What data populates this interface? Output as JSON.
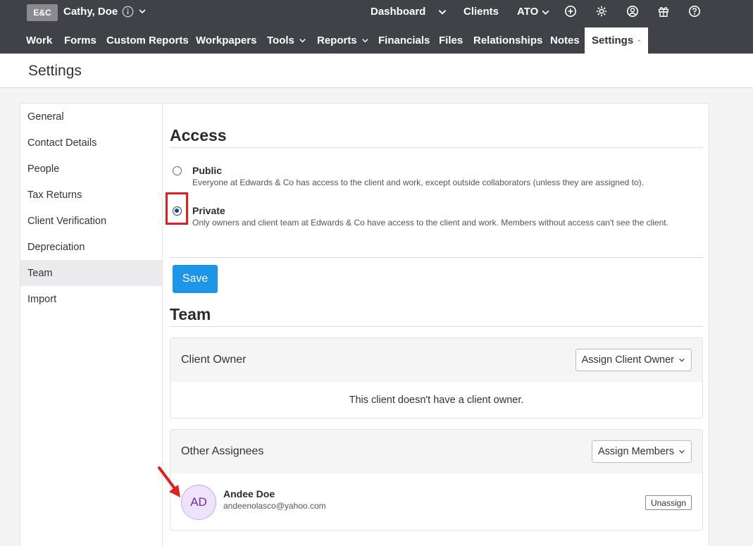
{
  "topbar": {
    "logo": "E&C",
    "client_name": "Cathy, Doe",
    "nav": {
      "dashboard": "Dashboard",
      "clients": "Clients",
      "ato": "ATO"
    }
  },
  "tabs": [
    "Work",
    "Forms",
    "Custom Reports",
    "Workpapers",
    "Tools",
    "Reports",
    "Financials",
    "Files",
    "Relationships",
    "Notes",
    "Settings"
  ],
  "page": {
    "title": "Settings"
  },
  "sidebar": {
    "items": [
      {
        "label": "General"
      },
      {
        "label": "Contact Details"
      },
      {
        "label": "People"
      },
      {
        "label": "Tax Returns"
      },
      {
        "label": "Client Verification"
      },
      {
        "label": "Depreciation"
      },
      {
        "label": "Team"
      },
      {
        "label": "Import"
      }
    ],
    "active": "Team"
  },
  "access": {
    "heading": "Access",
    "options": [
      {
        "title": "Public",
        "desc": "Everyone at Edwards & Co has access to the client and work, except outside collaborators (unless they are assigned to).",
        "selected": false
      },
      {
        "title": "Private",
        "desc": "Only owners and client team at Edwards & Co have access to the client and work. Members without access can't see the client.",
        "selected": true
      }
    ],
    "save_label": "Save"
  },
  "team": {
    "heading": "Team",
    "client_owner": {
      "title": "Client Owner",
      "button": "Assign Client Owner",
      "empty": "This client doesn't have a client owner."
    },
    "other_assignees": {
      "title": "Other Assignees",
      "button": "Assign Members",
      "members": [
        {
          "initials": "AD",
          "name": "Andee Doe",
          "email": "andeenolasco@yahoo.com",
          "action": "Unassign"
        }
      ]
    }
  },
  "colors": {
    "topbar": "#414148",
    "primary": "#1d95e8",
    "radio": "#1e3f8f",
    "annotation": "#e02020",
    "avatar_bg": "#efe3fb",
    "avatar_text": "#6b2fa6"
  }
}
